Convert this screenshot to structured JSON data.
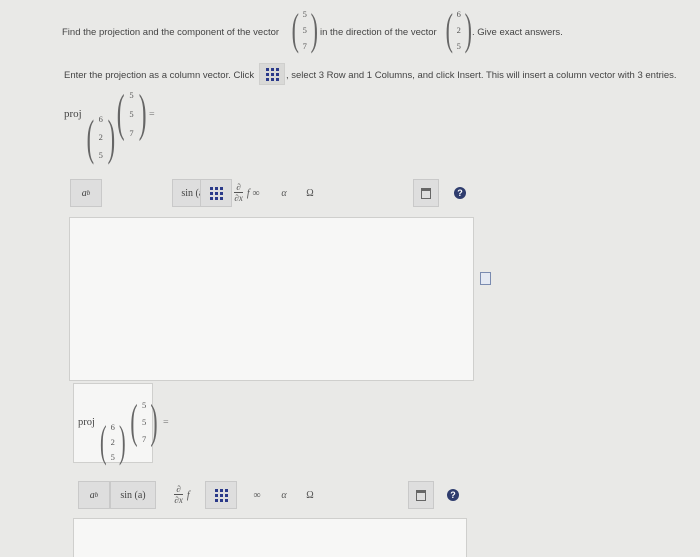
{
  "question": {
    "prefix": "Find the projection and the component of the vector",
    "middle": "in the direction of the vector",
    "suffix": ". Give exact answers.",
    "vector_v": [
      "5",
      "5",
      "7"
    ],
    "vector_u": [
      "6",
      "2",
      "5"
    ]
  },
  "instruction": {
    "prefix": "Enter the projection as a column vector. Click",
    "suffix": ", select 3 Row and 1 Columns, and click Insert. This will insert a column vector with 3 entries."
  },
  "answer1": {
    "proj_label": "proj",
    "sub_vector": [
      "6",
      "2",
      "5"
    ],
    "vector": [
      "5",
      "5",
      "7"
    ],
    "equals": "="
  },
  "toolbar": {
    "power_base": "a",
    "power_exp": "b",
    "sin_label": "sin (a)",
    "deriv_top": "∂",
    "deriv_bottom": "∂x",
    "deriv_f": "f",
    "infinity": "∞",
    "alpha": "α",
    "omega": "Ω",
    "help": "?"
  },
  "answer2": {
    "proj_label": "proj",
    "sub_vector": [
      "6",
      "2",
      "5"
    ],
    "vector": [
      "5",
      "5",
      "7"
    ],
    "equals": "="
  }
}
